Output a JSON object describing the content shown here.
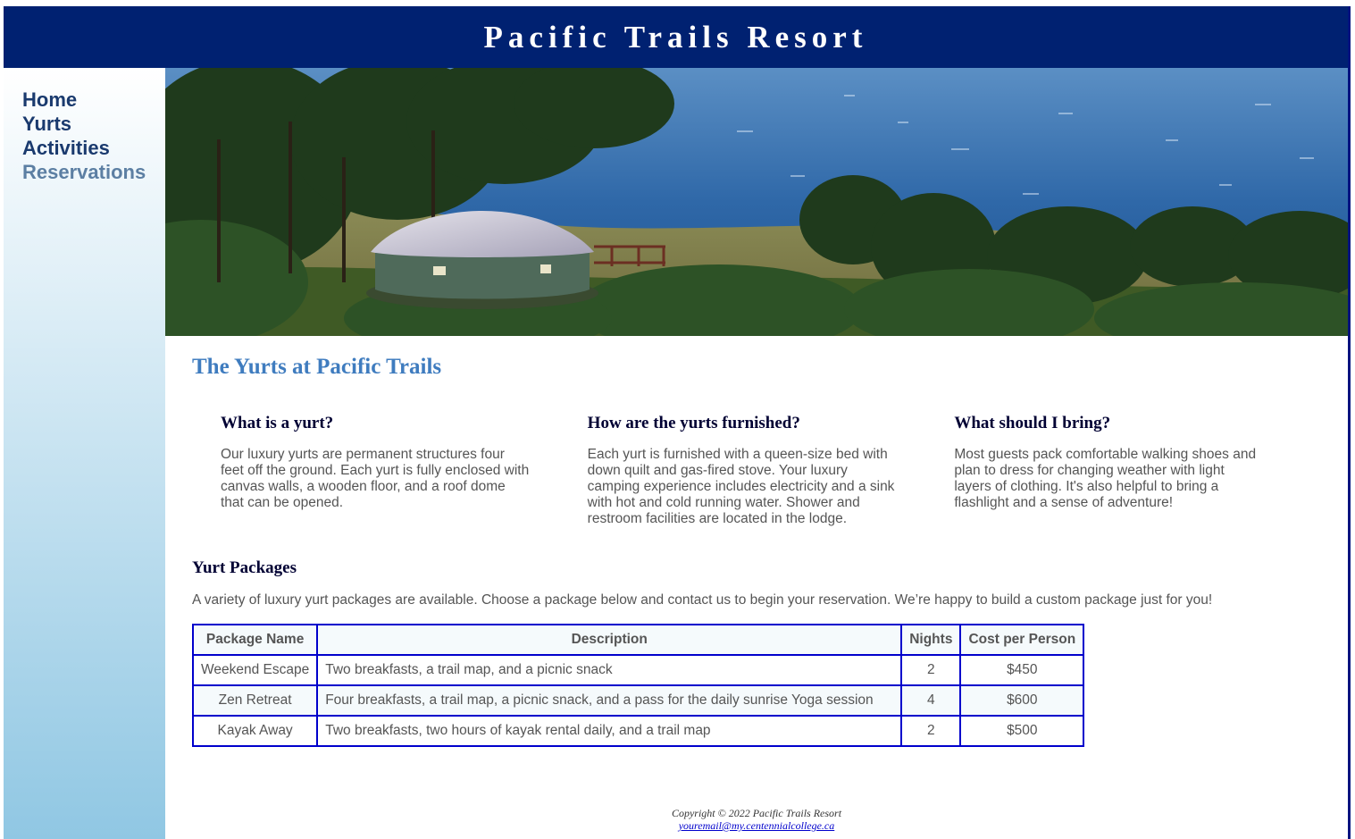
{
  "header": {
    "title": "Pacific Trails Resort"
  },
  "nav": {
    "items": [
      {
        "label": "Home",
        "visited": false
      },
      {
        "label": "Yurts",
        "visited": false
      },
      {
        "label": "Activities",
        "visited": false
      },
      {
        "label": "Reservations",
        "visited": true
      }
    ]
  },
  "main": {
    "page_title": "The Yurts at Pacific Trails",
    "columns": [
      {
        "heading": "What is a yurt?",
        "text": "Our luxury yurts are permanent structures four feet off the ground. Each yurt is fully enclosed with canvas walls, a wooden floor, and a roof dome that can be opened."
      },
      {
        "heading": "How are the yurts furnished?",
        "text": "Each yurt is furnished with a queen-size bed with down quilt and gas-fired stove. Your luxury camping experience includes electricity and a sink with hot and cold running water. Shower and restroom facilities are located in the lodge."
      },
      {
        "heading": "What should I bring?",
        "text": "Most guests pack comfortable walking shoes and plan to dress for changing weather with light layers of clothing. It's also helpful to bring a flashlight and a sense of adventure!"
      }
    ],
    "packages_title": "Yurt Packages",
    "packages_intro": "A variety of luxury yurt packages are available. Choose a package below and contact us to begin your reservation. We’re happy to build a custom package just for you!",
    "table": {
      "headers": [
        "Package Name",
        "Description",
        "Nights",
        "Cost per Person"
      ],
      "rows": [
        [
          "Weekend Escape",
          "Two breakfasts, a trail map, and a picnic snack",
          "2",
          "$450"
        ],
        [
          "Zen Retreat",
          "Four breakfasts, a trail map, a picnic snack, and a pass for the daily sunrise Yoga session",
          "4",
          "$600"
        ],
        [
          "Kayak Away",
          "Two breakfasts, two hours of kayak rental daily, and a trail map",
          "2",
          "$500"
        ]
      ]
    }
  },
  "footer": {
    "copyright": "Copyright © 2022 Pacific Trails Resort",
    "email": "youremail@my.centennialcollege.ca"
  },
  "colors": {
    "header_bg": "#002171",
    "title_blue": "#3f7cbf",
    "table_border": "#0000cc",
    "nav_gradient_end": "#90c7e3"
  }
}
